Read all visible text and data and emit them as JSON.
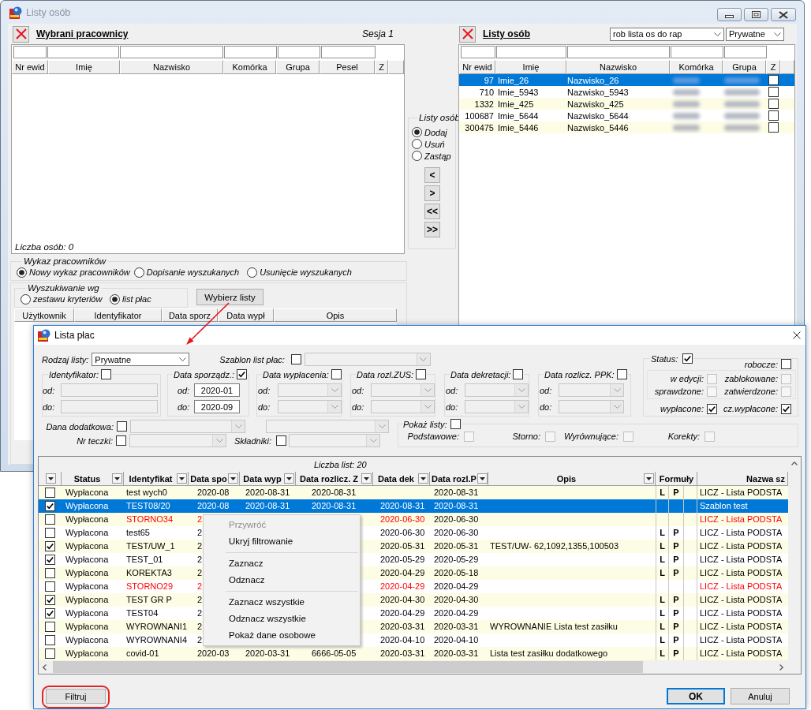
{
  "back_window": {
    "title": "Listy osób",
    "selected_panel": {
      "title": "Wybrani pracownicy",
      "session": "Sesja 1",
      "columns": [
        "Nr ewid",
        "Imię",
        "Nazwisko",
        "Komórka",
        "Grupa",
        "Pesel",
        "Z"
      ],
      "count": "Liczba osób: 0"
    },
    "employee_list": {
      "legend": "Wykaz pracowników",
      "options": [
        {
          "label": "Nowy wykaz pracowników",
          "selected": true
        },
        {
          "label": "Dopisanie wyszukanych",
          "selected": false
        },
        {
          "label": "Usunięcie wyszukanych",
          "selected": false
        }
      ]
    },
    "search_by": {
      "legend": "Wyszukiwanie wg",
      "options": [
        {
          "label": "zestawu kryteriów",
          "selected": false
        },
        {
          "label": "list płac",
          "selected": true
        }
      ],
      "button": "Wybierz listy",
      "columns": [
        "Użytkownik",
        "Identyfikator",
        "Data sporz",
        "Data wypł",
        "Opis"
      ]
    },
    "transfer": {
      "legend": "Listy osób",
      "options": [
        {
          "label": "Dodaj",
          "selected": true
        },
        {
          "label": "Usuń",
          "selected": false
        },
        {
          "label": "Zastąp",
          "selected": false
        }
      ],
      "buttons": [
        "<",
        ">",
        "<<",
        ">>"
      ]
    },
    "lists_panel": {
      "title": "Listy osób",
      "list": "rob lista os do rap",
      "type": "Prywatne",
      "columns": [
        "Nr ewid",
        "Imię",
        "Nazwisko",
        "Komórka",
        "Grupa",
        "Z"
      ],
      "rows": [
        {
          "nr": "97",
          "first_name": "Imie_26",
          "last_name": "Nazwisko_26",
          "blurred": true,
          "z": false,
          "selected": true
        },
        {
          "nr": "710",
          "first_name": "Imie_5943",
          "last_name": "Nazwisko_5943",
          "blurred": true,
          "z": false,
          "selected": false
        },
        {
          "nr": "1332",
          "first_name": "Imie_425",
          "last_name": "Nazwisko_425",
          "blurred": true,
          "z": false,
          "selected": false
        },
        {
          "nr": "100687",
          "first_name": "Imie_5644",
          "last_name": "Nazwisko_5644",
          "blurred": true,
          "z": false,
          "selected": false
        },
        {
          "nr": "300475",
          "first_name": "Imie_5446",
          "last_name": "Nazwisko_5446",
          "blurred": true,
          "z": false,
          "selected": false
        }
      ]
    }
  },
  "dialog": {
    "title": "Lista płac",
    "list_type": {
      "label": "Rodzaj listy:",
      "value": "Prywatne"
    },
    "template": {
      "label": "Szablon list płac:",
      "checked": false
    },
    "date_filters": [
      {
        "kind": "text",
        "label": "Identyfikator:",
        "checked": false,
        "from_label": "od:",
        "to_label": "do:"
      },
      {
        "kind": "text",
        "label": "Data sporządz.:",
        "checked": true,
        "from_label": "od:",
        "to_label": "do:",
        "from": "2020-01",
        "to": "2020-09"
      },
      {
        "kind": "combo",
        "label": "Data wypłacenia:",
        "checked": false,
        "from_label": "od:",
        "to_label": "do:"
      },
      {
        "kind": "combo",
        "label": "Data rozl.ZUS:",
        "checked": false,
        "from_label": "od:",
        "to_label": "do:"
      },
      {
        "kind": "combo",
        "label": "Data dekretacji:",
        "checked": false,
        "from_label": "od:",
        "to_label": "do:"
      },
      {
        "kind": "combo",
        "label": "Data rozlicz. PPK:",
        "checked": false,
        "from_label": "od:",
        "to_label": "do:"
      }
    ],
    "status": {
      "label": "Status:",
      "checked": true,
      "working": {
        "label": "robocze:",
        "checked": false
      },
      "review": [
        {
          "label": "w edycji:",
          "checked": false,
          "disabled": true
        },
        {
          "label": "zablokowane:",
          "checked": false,
          "disabled": true
        },
        {
          "label": "sprawdzone:",
          "checked": false,
          "disabled": true
        },
        {
          "label": "zatwierdzone:",
          "checked": false,
          "disabled": true
        }
      ],
      "paid": [
        {
          "label": "wypłacone:",
          "checked": true
        },
        {
          "label": "cz.wypłacone:",
          "checked": true
        }
      ]
    },
    "extra_data": {
      "label": "Dana dodatkowa:",
      "checked": false
    },
    "folder": {
      "label": "Nr teczki:",
      "checked": false
    },
    "components": {
      "label": "Składniki:",
      "checked": false
    },
    "show_lists": {
      "label": "Pokaż listy:",
      "checked": false,
      "options": [
        {
          "label": "Podstawowe:",
          "checked": false,
          "disabled": true
        },
        {
          "label": "Storno:",
          "checked": false,
          "disabled": true
        },
        {
          "label": "Wyrównujące:",
          "checked": false,
          "disabled": true
        },
        {
          "label": "Korekty:",
          "checked": false,
          "disabled": true
        }
      ]
    },
    "table": {
      "count": "Liczba list: 20",
      "columns": [
        {
          "filter": true
        },
        {
          "label": "Status",
          "filter": true
        },
        {
          "label": "Identyfikat",
          "filter": true
        },
        {
          "label": "Data spo",
          "filter": true
        },
        {
          "label": "Data wyp",
          "filter": true
        },
        {
          "label": "Data rozlicz. Z",
          "filter": true
        },
        {
          "label": "Data dek",
          "filter": true
        },
        {
          "label": "Data rozl.P",
          "filter": true
        },
        {
          "label": "Opis",
          "filter": true
        },
        {
          "label": "Formuły",
          "filter": false
        },
        {
          "label": "Nazwa sz",
          "filter": false
        }
      ],
      "rows": [
        {
          "checked": false,
          "selected": false,
          "storno": false,
          "status": "Wypłacona",
          "id": "test wych0",
          "data_spo": "2020-08",
          "data_wyp": "2020-08-31",
          "data_zus": "2020-08-31",
          "data_ppk": "2020-08-31",
          "formula_l": "L",
          "formula_p": "P",
          "nazwa": "LICZ - Lista PODSTA"
        },
        {
          "checked": true,
          "selected": true,
          "storno": false,
          "status": "Wypłacona",
          "id": "TEST08/20",
          "data_spo": "2020-08",
          "data_wyp": "2020-08-31",
          "data_zus": "2020-08-31",
          "data_dek": "2020-08-31",
          "data_ppk": "2020-08-31",
          "nazwa": "Szablon test"
        },
        {
          "checked": false,
          "selected": false,
          "storno": true,
          "status": "Wypłacona",
          "id": "STORNO34",
          "data_spo": "2",
          "data_dek": "2020-06-30",
          "data_ppk": "2020-06-30",
          "nazwa": "LICZ - Lista PODSTA"
        },
        {
          "checked": false,
          "selected": false,
          "storno": false,
          "status": "Wypłacona",
          "id": "test65",
          "data_spo": "2",
          "data_dek": "2020-06-30",
          "data_ppk": "2020-06-30",
          "formula_l": "L",
          "formula_p": "P",
          "nazwa": "LICZ - Lista PODSTA"
        },
        {
          "checked": true,
          "selected": false,
          "storno": false,
          "status": "Wypłacona",
          "id": "TEST/UW_1",
          "data_spo": "2",
          "data_dek": "2020-05-31",
          "data_ppk": "2020-05-31",
          "opis": "TEST/UW- 62,1092,1355,100503",
          "formula_l": "L",
          "formula_p": "P",
          "nazwa": "LICZ - Lista PODSTA"
        },
        {
          "checked": true,
          "selected": false,
          "storno": false,
          "status": "Wypłacona",
          "id": "TEST_01",
          "data_spo": "2",
          "data_dek": "2020-05-29",
          "data_ppk": "2020-05-29",
          "formula_l": "L",
          "formula_p": "P",
          "nazwa": "LICZ - Lista PODSTA"
        },
        {
          "checked": false,
          "selected": false,
          "storno": false,
          "status": "Wypłacona",
          "id": "KOREKTA3",
          "data_spo": "2",
          "data_dek": "2020-04-29",
          "data_ppk": "2020-05-18",
          "formula_l": "L",
          "formula_p": "P",
          "nazwa": "LICZ - Lista PODSTA"
        },
        {
          "checked": false,
          "selected": false,
          "storno": true,
          "status": "Wypłacona",
          "id": "STORNO29",
          "data_spo": "2",
          "data_dek": "2020-04-29",
          "data_ppk": "2020-04-29",
          "nazwa": "LICZ - Lista PODSTA"
        },
        {
          "checked": true,
          "selected": false,
          "storno": false,
          "status": "Wypłacona",
          "id": "TEST GR P",
          "data_spo": "2",
          "data_dek": "2020-04-30",
          "data_ppk": "2020-04-30",
          "formula_l": "L",
          "formula_p": "P",
          "nazwa": "LICZ - Lista PODSTA"
        },
        {
          "checked": true,
          "selected": false,
          "storno": false,
          "status": "Wypłacona",
          "id": "TEST04",
          "data_spo": "2",
          "data_dek": "2020-04-29",
          "data_ppk": "2020-04-29",
          "formula_l": "L",
          "formula_p": "P",
          "nazwa": "LICZ - Lista PODSTA"
        },
        {
          "checked": false,
          "selected": false,
          "storno": false,
          "status": "Wypłacona",
          "id": "WYROWNANI1",
          "data_spo": "2",
          "data_dek": "2020-03-31",
          "data_ppk": "2020-03-31",
          "opis": "WYROWNANIE Lista test zasiłku",
          "formula_l": "L",
          "formula_p": "P",
          "nazwa": "LICZ - Lista PODSTA"
        },
        {
          "checked": false,
          "selected": false,
          "storno": false,
          "status": "Wypłacona",
          "id": "WYROWNANI4",
          "data_spo": "2",
          "data_dek": "2020-04-10",
          "data_ppk": "2020-04-10",
          "formula_l": "L",
          "formula_p": "P",
          "nazwa": "LICZ - Lista PODSTA"
        },
        {
          "checked": false,
          "selected": false,
          "storno": false,
          "status": "Wypłacona",
          "id": "covid-01",
          "data_spo": "2020-03",
          "data_wyp": "2020-03-31",
          "data_zus": "6666-05-05",
          "data_dek": "2020-03-31",
          "data_ppk": "2020-03-31",
          "opis": "Lista test zasiłku dodatkowego",
          "formula_l": "L",
          "formula_p": "P",
          "nazwa": "LICZ - Lista PODSTA"
        }
      ]
    },
    "context_menu": [
      {
        "kind": "item",
        "label": "Przywróć",
        "disabled": true
      },
      {
        "kind": "item",
        "label": "Ukryj filtrowanie",
        "disabled": false
      },
      {
        "kind": "separator"
      },
      {
        "kind": "item",
        "label": "Zaznacz",
        "disabled": false
      },
      {
        "kind": "item",
        "label": "Odznacz",
        "disabled": false
      },
      {
        "kind": "separator"
      },
      {
        "kind": "item",
        "label": "Zaznacz wszystkie",
        "disabled": false
      },
      {
        "kind": "item",
        "label": "Odznacz wszystkie",
        "disabled": false
      },
      {
        "kind": "item",
        "label": "Pokaż dane osobowe",
        "disabled": false
      }
    ],
    "buttons": {
      "filter": "Filtruj",
      "ok": "OK",
      "cancel": "Anuluj"
    }
  },
  "annotations": [
    {
      "kind": "arrow"
    },
    {
      "kind": "outline"
    }
  ]
}
